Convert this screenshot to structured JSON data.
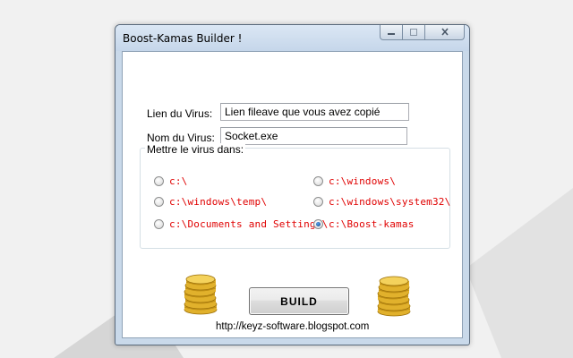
{
  "window": {
    "title": "Boost-Kamas Builder !",
    "controls": {
      "minimize": "▭",
      "maximize": "▢",
      "close": "✕"
    }
  },
  "form": {
    "virus_link_label": "Lien du Virus:",
    "virus_link_value": "Lien fileave que vous avez copié",
    "virus_name_label": "Nom du Virus:",
    "virus_name_value": "Socket.exe"
  },
  "location_group": {
    "title": "Mettre le virus dans:",
    "options": [
      {
        "label": "c:\\",
        "checked": false
      },
      {
        "label": "c:\\windows\\temp\\",
        "checked": false
      },
      {
        "label": "c:\\Documents and Settings\\",
        "checked": false
      },
      {
        "label": "c:\\windows\\",
        "checked": false
      },
      {
        "label": "c:\\windows\\system32\\",
        "checked": false
      },
      {
        "label": "c:\\Boost-kamas",
        "checked": true
      }
    ]
  },
  "build_button": "BUILD",
  "footer_link": "http://keyz-software.blogspot.com",
  "icons": {
    "coins_left": "gold-coins-icon",
    "coins_right": "gold-coins-icon"
  },
  "colors": {
    "option_text": "#e00000",
    "window_frame": "#c9d9ea"
  }
}
